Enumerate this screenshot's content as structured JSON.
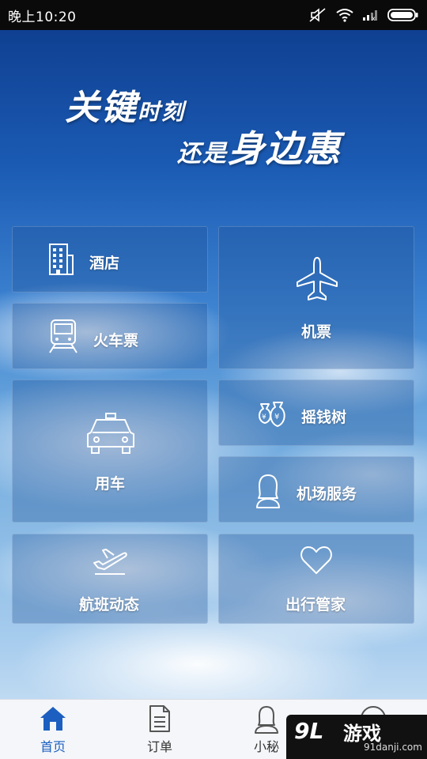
{
  "status_bar": {
    "time": "晚上10:20",
    "icons": [
      "mute-icon",
      "wifi-icon",
      "signal-icon",
      "battery-icon"
    ]
  },
  "slogan": {
    "line1_big": "关键",
    "line1_small": "时刻",
    "line2_small": "还是",
    "line2_big": "身边惠"
  },
  "tiles": {
    "hotel": {
      "label": "酒店",
      "icon": "hotel-building-icon"
    },
    "flight": {
      "label": "机票",
      "icon": "airplane-icon"
    },
    "train": {
      "label": "火车票",
      "icon": "train-icon"
    },
    "money_tree": {
      "label": "摇钱树",
      "icon": "money-bags-icon"
    },
    "car": {
      "label": "用车",
      "icon": "car-icon"
    },
    "airport_service": {
      "label": "机场服务",
      "icon": "person-bust-icon"
    },
    "flight_status": {
      "label": "航班动态",
      "icon": "plane-takeoff-icon"
    },
    "travel_butler": {
      "label": "出行管家",
      "icon": "heart-icon"
    }
  },
  "bottom_nav": {
    "items": [
      {
        "label": "首页",
        "icon": "home-icon",
        "active": true
      },
      {
        "label": "订单",
        "icon": "document-icon",
        "active": false
      },
      {
        "label": "小秘",
        "icon": "assistant-icon",
        "active": false
      },
      {
        "label": "",
        "icon": "user-icon",
        "active": false
      }
    ]
  },
  "watermark": {
    "logo": "9L",
    "main": "游戏",
    "sub": "91danji.com"
  },
  "colors": {
    "nav_active": "#1c5fc0",
    "tile_bg": "rgba(30,80,150,0.32)",
    "sky_top": "#0d3a8a"
  }
}
